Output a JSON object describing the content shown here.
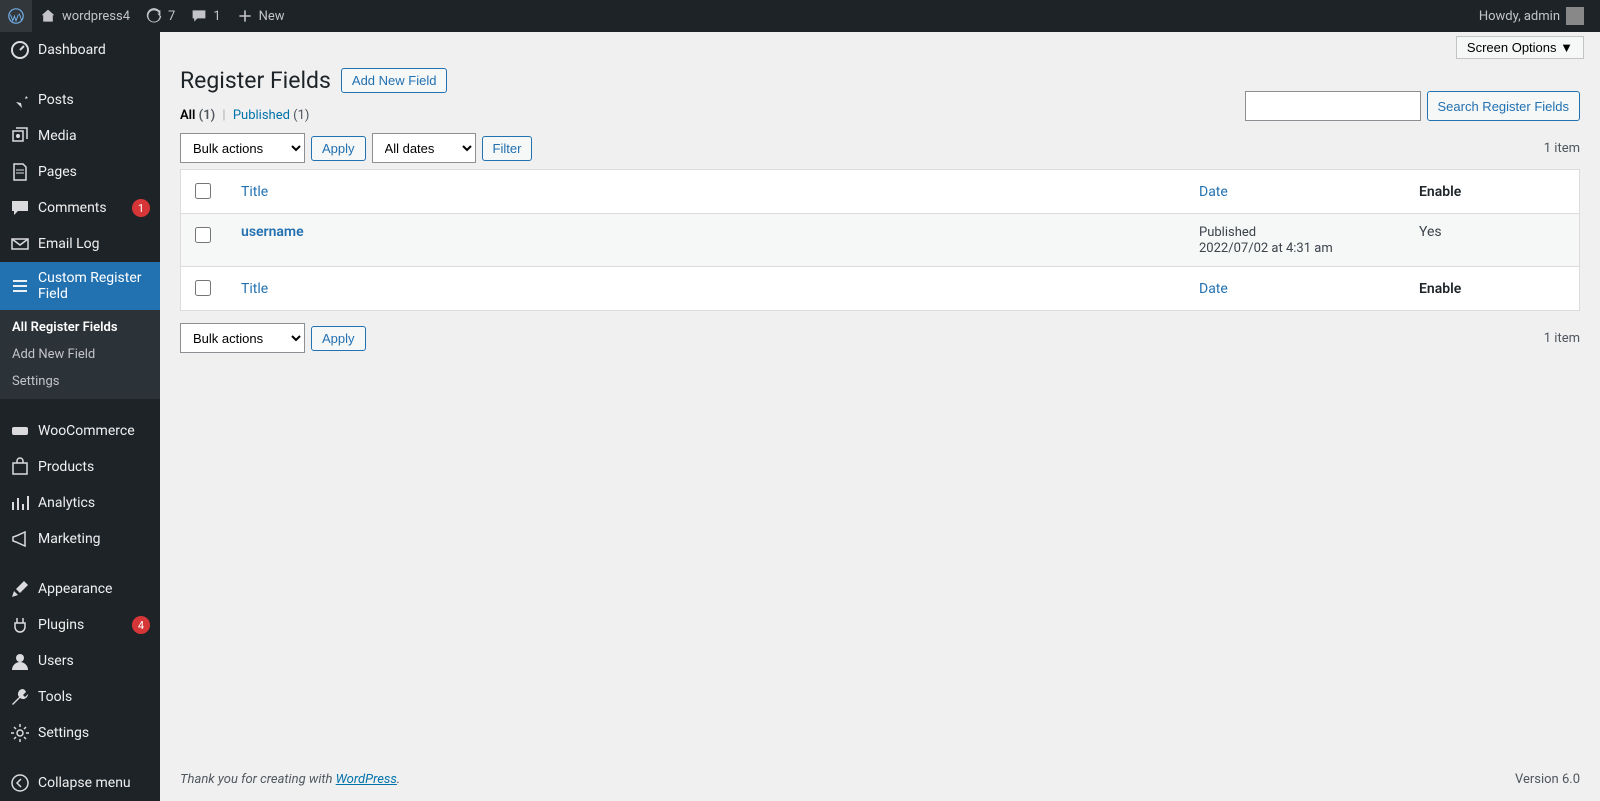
{
  "adminbar": {
    "site_name": "wordpress4",
    "updates": "7",
    "comments": "1",
    "new": "New",
    "howdy": "Howdy, admin"
  },
  "sidebar": {
    "items": [
      {
        "label": "Dashboard",
        "icon": "dash"
      },
      {
        "label": "Posts",
        "icon": "pin"
      },
      {
        "label": "Media",
        "icon": "media"
      },
      {
        "label": "Pages",
        "icon": "page"
      },
      {
        "label": "Comments",
        "icon": "comment",
        "badge": "1"
      },
      {
        "label": "Email Log",
        "icon": "mail"
      },
      {
        "label": "Custom Register Field",
        "icon": "list"
      },
      {
        "label": "WooCommerce",
        "icon": "woo"
      },
      {
        "label": "Products",
        "icon": "product"
      },
      {
        "label": "Analytics",
        "icon": "chart"
      },
      {
        "label": "Marketing",
        "icon": "megaphone"
      },
      {
        "label": "Appearance",
        "icon": "brush"
      },
      {
        "label": "Plugins",
        "icon": "plug",
        "badge": "4"
      },
      {
        "label": "Users",
        "icon": "user"
      },
      {
        "label": "Tools",
        "icon": "tool"
      },
      {
        "label": "Settings",
        "icon": "cog"
      },
      {
        "label": "Collapse menu",
        "icon": "collapse"
      }
    ],
    "submenu": {
      "items": [
        "All Register Fields",
        "Add New Field",
        "Settings"
      ]
    }
  },
  "screen_options": "Screen Options ▼",
  "heading": {
    "title": "Register Fields",
    "add_new": "Add New Field"
  },
  "subsub": {
    "all_label": "All",
    "all_count": "(1)",
    "published_label": "Published",
    "published_count": "(1)"
  },
  "search": {
    "button": "Search Register Fields"
  },
  "bulk": {
    "actions": "Bulk actions",
    "apply": "Apply",
    "dates": "All dates",
    "filter": "Filter"
  },
  "pagination": {
    "count": "1 item"
  },
  "table": {
    "cols": {
      "title": "Title",
      "date": "Date",
      "enable": "Enable"
    },
    "rows": [
      {
        "title": "username",
        "status": "Published",
        "datetime": "2022/07/02 at 4:31 am",
        "enable": "Yes"
      }
    ]
  },
  "footer": {
    "prefix": "Thank you for creating with ",
    "link": "WordPress",
    "suffix": ".",
    "version": "Version 6.0"
  }
}
